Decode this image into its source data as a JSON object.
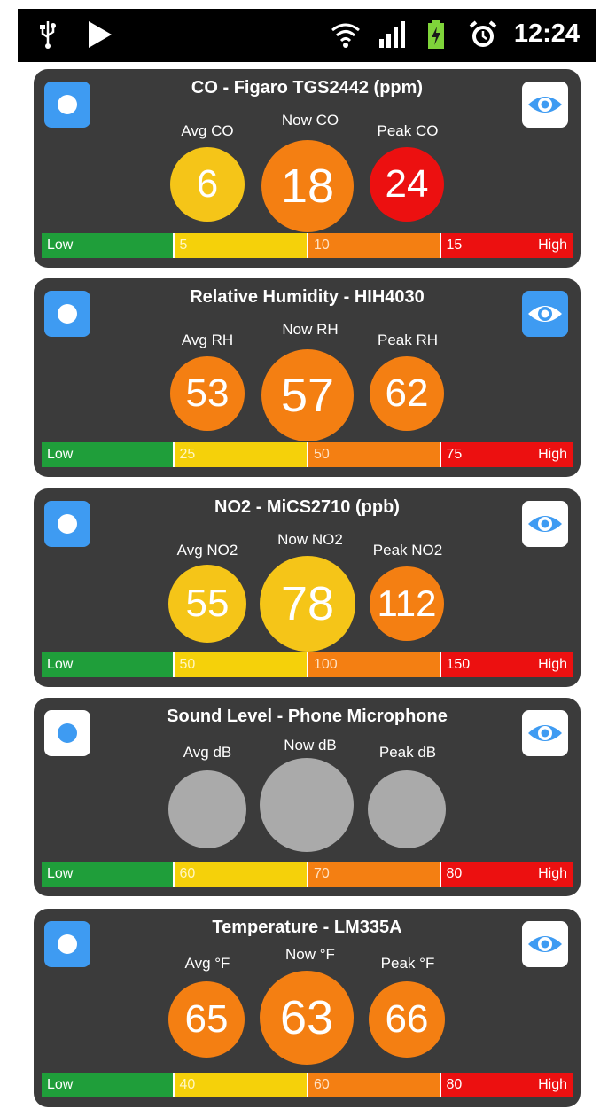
{
  "status_bar": {
    "time": "12:24",
    "icons": [
      "usb-icon",
      "play-store-icon",
      "wifi-icon",
      "signal-icon",
      "battery-charging-icon",
      "alarm-icon"
    ]
  },
  "colors": {
    "card_bg": "#3b3b3b",
    "accent_blue": "#3e9bf2",
    "level_green": "#1f9e3a",
    "level_yellow": "#f5d10a",
    "level_orange": "#f47f12",
    "level_red": "#ec1010",
    "inactive_gray": "#aaaaaa"
  },
  "cards": [
    {
      "title": "CO - Figaro TGS2442 (ppm)",
      "toggle_on": true,
      "eye_on": false,
      "avg": {
        "label": "Avg CO",
        "value": "6",
        "color": "#f5c518"
      },
      "now": {
        "label": "Now CO",
        "value": "18",
        "color": "#f47f12"
      },
      "peak": {
        "label": "Peak CO",
        "value": "24",
        "color": "#ec1010"
      },
      "scale": {
        "low": "Low",
        "t1": "5",
        "t2": "10",
        "t3": "15",
        "high": "High"
      }
    },
    {
      "title": "Relative Humidity - HIH4030",
      "toggle_on": true,
      "eye_on": true,
      "avg": {
        "label": "Avg RH",
        "value": "53",
        "color": "#f47f12"
      },
      "now": {
        "label": "Now RH",
        "value": "57",
        "color": "#f47f12"
      },
      "peak": {
        "label": "Peak RH",
        "value": "62",
        "color": "#f47f12"
      },
      "scale": {
        "low": "Low",
        "t1": "25",
        "t2": "50",
        "t3": "75",
        "high": "High"
      }
    },
    {
      "title": "NO2 - MiCS2710 (ppb)",
      "toggle_on": true,
      "eye_on": false,
      "avg": {
        "label": "Avg NO2",
        "value": "55",
        "color": "#f5c518"
      },
      "now": {
        "label": "Now NO2",
        "value": "78",
        "color": "#f5c518"
      },
      "peak": {
        "label": "Peak NO2",
        "value": "112",
        "color": "#f47f12"
      },
      "scale": {
        "low": "Low",
        "t1": "50",
        "t2": "100",
        "t3": "150",
        "high": "High"
      }
    },
    {
      "title": "Sound Level - Phone Microphone",
      "toggle_on": false,
      "eye_on": false,
      "avg": {
        "label": "Avg dB",
        "value": "",
        "color": "#aaaaaa"
      },
      "now": {
        "label": "Now dB",
        "value": "",
        "color": "#aaaaaa"
      },
      "peak": {
        "label": "Peak dB",
        "value": "",
        "color": "#aaaaaa"
      },
      "scale": {
        "low": "Low",
        "t1": "60",
        "t2": "70",
        "t3": "80",
        "high": "High"
      }
    },
    {
      "title": "Temperature - LM335A",
      "toggle_on": true,
      "eye_on": false,
      "avg": {
        "label": "Avg °F",
        "value": "65",
        "color": "#f47f12"
      },
      "now": {
        "label": "Now °F",
        "value": "63",
        "color": "#f47f12"
      },
      "peak": {
        "label": "Peak °F",
        "value": "66",
        "color": "#f47f12"
      },
      "scale": {
        "low": "Low",
        "t1": "40",
        "t2": "60",
        "t3": "80",
        "high": "High"
      }
    }
  ]
}
